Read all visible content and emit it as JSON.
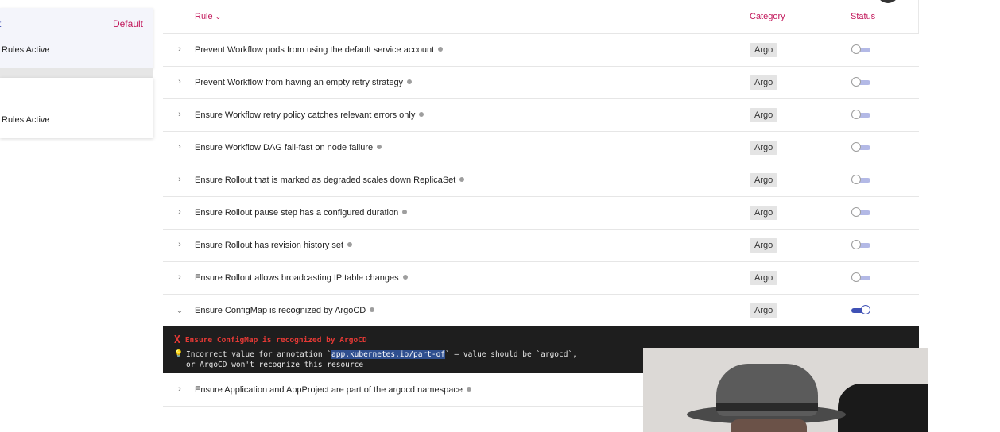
{
  "policy_cards": [
    {
      "mark": "t",
      "default_label": "Default",
      "rules_text": "Rules Active"
    },
    {
      "rules_text": "Rules Active"
    }
  ],
  "table": {
    "headers": {
      "rule": "Rule",
      "rule_sort_icon": "chevron-down-icon",
      "category": "Category",
      "status": "Status"
    },
    "rows": [
      {
        "name": "Prevent Workflow pods from using the default service account",
        "category": "Argo",
        "enabled": false,
        "expanded": false
      },
      {
        "name": "Prevent Workflow from having an empty retry strategy",
        "category": "Argo",
        "enabled": false,
        "expanded": false
      },
      {
        "name": "Ensure Workflow retry policy catches relevant errors only",
        "category": "Argo",
        "enabled": false,
        "expanded": false
      },
      {
        "name": "Ensure Workflow DAG fail-fast on node failure",
        "category": "Argo",
        "enabled": false,
        "expanded": false
      },
      {
        "name": "Ensure Rollout that is marked as degraded scales down ReplicaSet",
        "category": "Argo",
        "enabled": false,
        "expanded": false
      },
      {
        "name": "Ensure Rollout pause step has a configured duration",
        "category": "Argo",
        "enabled": false,
        "expanded": false
      },
      {
        "name": "Ensure Rollout has revision history set",
        "category": "Argo",
        "enabled": false,
        "expanded": false
      },
      {
        "name": "Ensure Rollout allows broadcasting IP table changes",
        "category": "Argo",
        "enabled": false,
        "expanded": false
      },
      {
        "name": "Ensure ConfigMap is recognized by ArgoCD",
        "category": "Argo",
        "enabled": true,
        "expanded": true
      },
      {
        "name": "Ensure Application and AppProject are part of the argocd namespace",
        "category": "",
        "enabled": false,
        "expanded": false
      }
    ]
  },
  "terminal": {
    "error_symbol": "X",
    "title": "Ensure ConfigMap is recognized by ArgoCD",
    "hint_icon": "lightbulb-icon",
    "line1_before": "Incorrect value for annotation `",
    "line1_highlight": "app.kubernetes.io/part-of",
    "line1_after": "` — value should be `argocd`,",
    "line2": "or ArgoCD won't recognize this resource"
  },
  "colors": {
    "accent_pink": "#c2185b",
    "toggle_blue": "#3f51b5",
    "error_red": "#e53935"
  }
}
